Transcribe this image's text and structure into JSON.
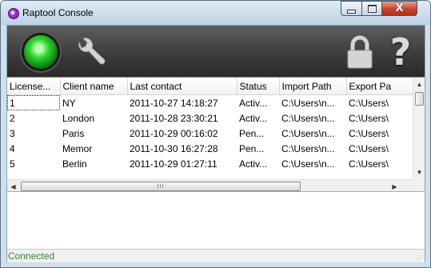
{
  "window": {
    "title": "Raptool Console"
  },
  "titlebar_buttons": {
    "minimize_icon": "minimize-icon",
    "maximize_icon": "maximize-icon",
    "close_icon": "close-icon",
    "close_glyph": "X"
  },
  "toolbar": {
    "connect_icon": "green-led-icon",
    "settings_icon": "wrench-icon",
    "lock_icon": "padlock-icon",
    "help_icon": "question-mark-icon",
    "help_glyph": "?",
    "led_color": "#2fd32f"
  },
  "table": {
    "columns": [
      "License...",
      "Client name",
      "Last contact",
      "Status",
      "Import Path",
      "Export Pa"
    ],
    "rows": [
      [
        "1",
        "NY",
        "2011-10-27 14:18:27",
        "Activ...",
        "C:\\Users\\n...",
        "C:\\Users\\"
      ],
      [
        "2",
        "London",
        "2011-10-28 23:30:21",
        "Activ...",
        "C:\\Users\\n...",
        "C:\\Users\\"
      ],
      [
        "3",
        "Paris",
        "2011-10-29 00:16:02",
        "Pen...",
        "C:\\Users\\n...",
        "C:\\Users\\"
      ],
      [
        "4",
        "Memor",
        "2011-10-30 16:27:28",
        "Pen...",
        "C:\\Users\\n...",
        "C:\\Users\\"
      ],
      [
        "5",
        "Berlin",
        "2011-10-29 01:27:11",
        "Activ...",
        "C:\\Users\\n...",
        "C:\\Users\\"
      ]
    ],
    "hscroll_thumb_label": "III"
  },
  "status": {
    "text": "Connected",
    "color": "#2e8b2e"
  }
}
